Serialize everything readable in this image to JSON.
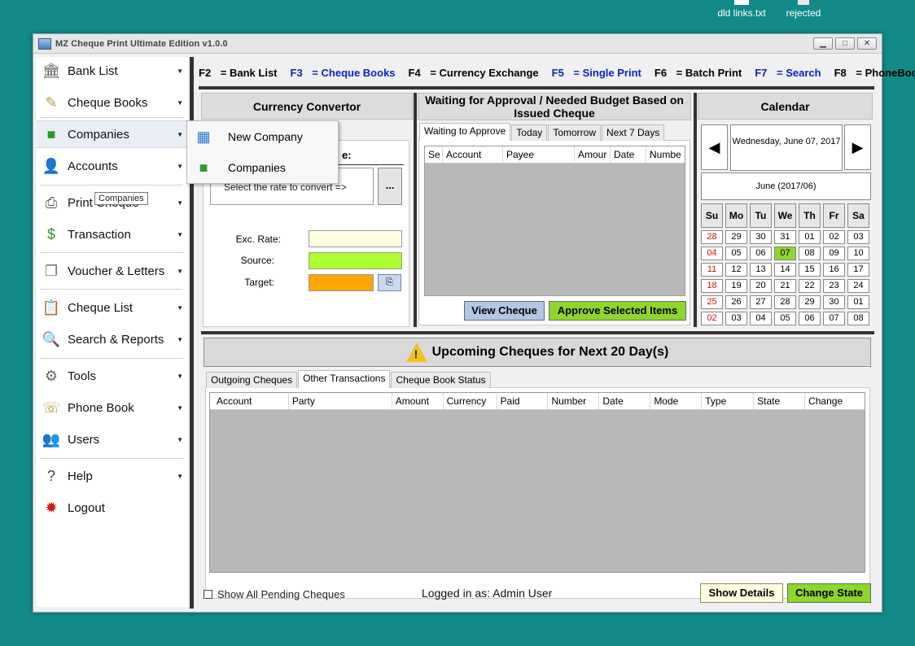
{
  "desktop": {
    "icons": [
      {
        "label": "dld links.txt"
      },
      {
        "label": "rejected"
      }
    ]
  },
  "window": {
    "title": "MZ Cheque Print Ultimate Edition v1.0.0",
    "controls": {
      "minimize": "▁",
      "maximize": "□",
      "close": "✕"
    }
  },
  "sidebar": {
    "items": [
      {
        "label": "Bank List",
        "icon": "bank-icon"
      },
      {
        "label": "Cheque Books",
        "icon": "cheque-book-icon"
      },
      {
        "label": "Companies",
        "icon": "companies-icon"
      },
      {
        "label": "Accounts",
        "icon": "accounts-icon"
      },
      {
        "label": "Print Cheque",
        "icon": "printer-icon"
      },
      {
        "label": "Transaction",
        "icon": "money-icon"
      },
      {
        "label": "Voucher & Letters",
        "icon": "documents-icon"
      },
      {
        "label": "Cheque List",
        "icon": "clipboard-icon"
      },
      {
        "label": "Search & Reports",
        "icon": "magnifier-icon"
      },
      {
        "label": "Tools",
        "icon": "gears-icon"
      },
      {
        "label": "Phone Book",
        "icon": "phone-book-icon"
      },
      {
        "label": "Users",
        "icon": "users-icon"
      },
      {
        "label": "Help",
        "icon": "help-icon"
      },
      {
        "label": "Logout",
        "icon": "logout-icon"
      }
    ],
    "tooltip": "Companies",
    "flyout": [
      {
        "label": "New Company",
        "icon": "new-company-icon"
      },
      {
        "label": "Companies",
        "icon": "companies-icon"
      }
    ]
  },
  "shortcuts": [
    {
      "key": "F2",
      "label": "Bank List",
      "color": "#000000"
    },
    {
      "key": "F3",
      "label": "Cheque Books",
      "color": "#0b24c8"
    },
    {
      "key": "F4",
      "label": "Currency Exchange",
      "color": "#000000"
    },
    {
      "key": "F5",
      "label": "Single Print",
      "color": "#0b24c8"
    },
    {
      "key": "F6",
      "label": "Batch Print",
      "color": "#000000"
    },
    {
      "key": "F7",
      "label": "Search",
      "color": "#0b24c8"
    },
    {
      "key": "F8",
      "label": "PhoneBook",
      "color": "#000000"
    }
  ],
  "converter": {
    "title": "Currency Convertor",
    "partial_label": "e:",
    "rate_placeholder": "Select the rate to convert =>",
    "dots": "...",
    "exc_rate_label": "Exc. Rate:",
    "source_label": "Source:",
    "target_label": "Target:",
    "colors": {
      "exc_rate": "#ffffe0",
      "source": "#adff2f",
      "target": "#ffa500"
    }
  },
  "approval": {
    "title": "Waiting for Approval / Needed Budget Based on Issued Cheque",
    "tabs": [
      "Waiting to Approve",
      "Today",
      "Tomorrow",
      "Next 7 Days"
    ],
    "columns": [
      "Se",
      "Account",
      "Payee",
      "Amour",
      "Date",
      "Numbe"
    ],
    "view_button": "View Cheque",
    "approve_button": "Approve Selected Items"
  },
  "calendar": {
    "title": "Calendar",
    "selected_date": "Wednesday, June 07, 2017",
    "month_label": "June  (2017/06)",
    "prev": "◀",
    "next": "▶",
    "weekdays": [
      "Su",
      "Mo",
      "Tu",
      "We",
      "Th",
      "Fr",
      "Sa"
    ],
    "weeks": [
      [
        "28",
        "29",
        "30",
        "31",
        "01",
        "02",
        "03"
      ],
      [
        "04",
        "05",
        "06",
        "07",
        "08",
        "09",
        "10"
      ],
      [
        "11",
        "12",
        "13",
        "14",
        "15",
        "16",
        "17"
      ],
      [
        "18",
        "19",
        "20",
        "21",
        "22",
        "23",
        "24"
      ],
      [
        "25",
        "26",
        "27",
        "28",
        "29",
        "30",
        "01"
      ],
      [
        "02",
        "03",
        "04",
        "05",
        "06",
        "07",
        "08"
      ]
    ],
    "today": "07"
  },
  "upcoming": {
    "title": "Upcoming Cheques for Next 20 Day(s)",
    "tabs": [
      "Outgoing Cheques",
      "Other Transactions",
      "Cheque Book Status"
    ],
    "columns": [
      "Account",
      "Party",
      "Amount",
      "Currency",
      "Paid",
      "Number",
      "Date",
      "Mode",
      "Type",
      "State",
      "Change"
    ]
  },
  "footer": {
    "show_all_label": "Show All Pending Cheques",
    "logged_in": "Logged in as: Admin User",
    "show_details": "Show Details",
    "change_state": "Change State"
  }
}
